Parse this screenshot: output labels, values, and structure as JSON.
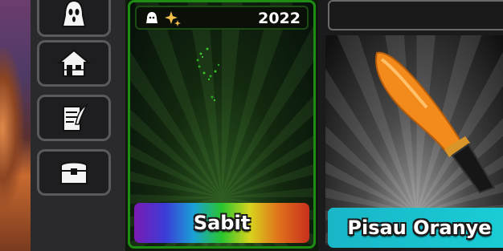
{
  "sidebar": {
    "buttons": [
      {
        "name": "avatar-menu-button",
        "icon": "ghostface-icon"
      },
      {
        "name": "home-button",
        "icon": "house-icon"
      },
      {
        "name": "quests-button",
        "icon": "scroll-quill-icon"
      },
      {
        "name": "inventory-button",
        "icon": "chest-icon"
      }
    ]
  },
  "items": [
    {
      "name": "Sabit",
      "year": "2022",
      "tag_icons": [
        "ghost-icon",
        "sparkle-icon"
      ],
      "rarity_bar": "rainbow",
      "accent": "#1f8d14"
    },
    {
      "name": "Pisau Oranye",
      "rarity_bar": "cyan",
      "accent": "#19cdd6"
    }
  ]
}
